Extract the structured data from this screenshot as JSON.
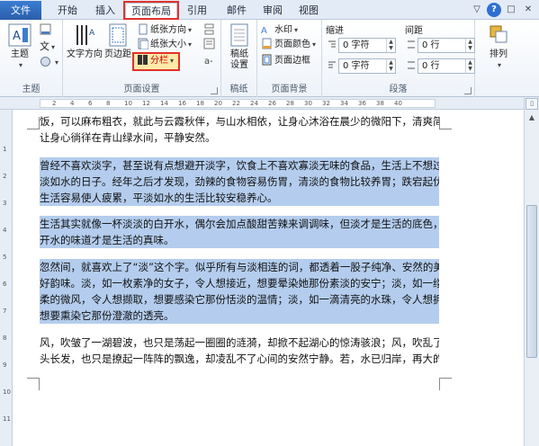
{
  "tabs": {
    "file": "文件",
    "home": "开始",
    "insert": "插入",
    "page_layout": "页面布局",
    "references": "引用",
    "mailings": "邮件",
    "review": "审阅",
    "view": "视图"
  },
  "window_controls": {
    "minimize": "▽",
    "help": "?",
    "restore": "□",
    "close": "✕"
  },
  "ribbon": {
    "themes": {
      "label": "主题",
      "theme_btn": "主题",
      "colors_icon": "文"
    },
    "page_setup": {
      "label": "页面设置",
      "text_direction": "文字方向",
      "margins": "页边距",
      "orientation": "纸张方向",
      "size": "纸张大小",
      "columns": "分栏"
    },
    "draft": {
      "label": "稿纸",
      "settings": "稿纸\n设置"
    },
    "page_background": {
      "label": "页面背景",
      "watermark": "水印",
      "page_color": "页面颜色",
      "page_borders": "页面边框"
    },
    "paragraph": {
      "label": "段落",
      "indent_title": "缩进",
      "spacing_title": "间距",
      "indent_left": "0 字符",
      "indent_right": "0 字符",
      "spacing_before": "0 行",
      "spacing_after": "0 行"
    },
    "arrange": {
      "label": "排列",
      "arrange_btn": "排列"
    }
  },
  "document": {
    "paragraphs": [
      {
        "lines": [
          "饭，可以麻布粗衣，就此与云霞秋伴，与山水相依，让身心沐浴在晨少的微阳下，清爽简净；",
          "让身心徜徉在青山绿水间，平静安然。"
        ],
        "selected": false
      },
      {
        "lines": [
          "曾经不喜欢淡字，甚至说有点想避开淡字，饮食上不喜欢寡淡无味的食品，生活上不想过平",
          "淡如水的日子。经年之后才发现，劲辣的食物容易伤胃，清淡的食物比较养胃；跌宕起伏的",
          "生活容易使人疲累，平淡如水的生活比较安稳养心。"
        ],
        "selected": true
      },
      {
        "lines": [
          "生活其实就像一杯淡淡的白开水，偶尔会加点酸甜苦辣来调调味，但淡才是生活的底色，白",
          "开水的味道才是生活的真味。"
        ],
        "selected": true
      },
      {
        "lines": [
          "忽然间，就喜欢上了“淡”这个字。似乎所有与淡相连的词，都透着一股子纯净、安然的美",
          "好韵味。淡，如一枚素净的女子，令人想接近，想要晕染她那份素淡的安宁；淡，如一缕轻",
          "柔的微风，令人想撷取，想要感染它那份恬淡的温情；淡，如一滴清亮的水珠，令人想拥有，",
          "想要熏染它那份澄澈的透亮。"
        ],
        "selected": true
      },
      {
        "lines": [
          "风，吹皱了一湖碧波，也只是荡起一圈圈的涟漪，却掀不起湖心的惊涛骇浪；风，吹乱了一",
          "头长发，也只是撩起一阵阵的飘逸，却凌乱不了心间的安然宁静。若，水已归岸，再大的风"
        ],
        "selected": false
      }
    ]
  },
  "ruler": {
    "numbers": [
      "2",
      "4",
      "6",
      "8",
      "10",
      "12",
      "14",
      "16",
      "18",
      "20",
      "22",
      "24",
      "26",
      "28",
      "30",
      "32",
      "34",
      "36",
      "38",
      "40"
    ]
  },
  "vruler": {
    "numbers": [
      "1",
      "2",
      "3",
      "4",
      "5",
      "6",
      "7",
      "8",
      "9",
      "10",
      "11"
    ]
  },
  "colors": {
    "selection": "#b4cdee",
    "highlight_box": "#e0322a",
    "file_tab": "#2a5ea9"
  }
}
